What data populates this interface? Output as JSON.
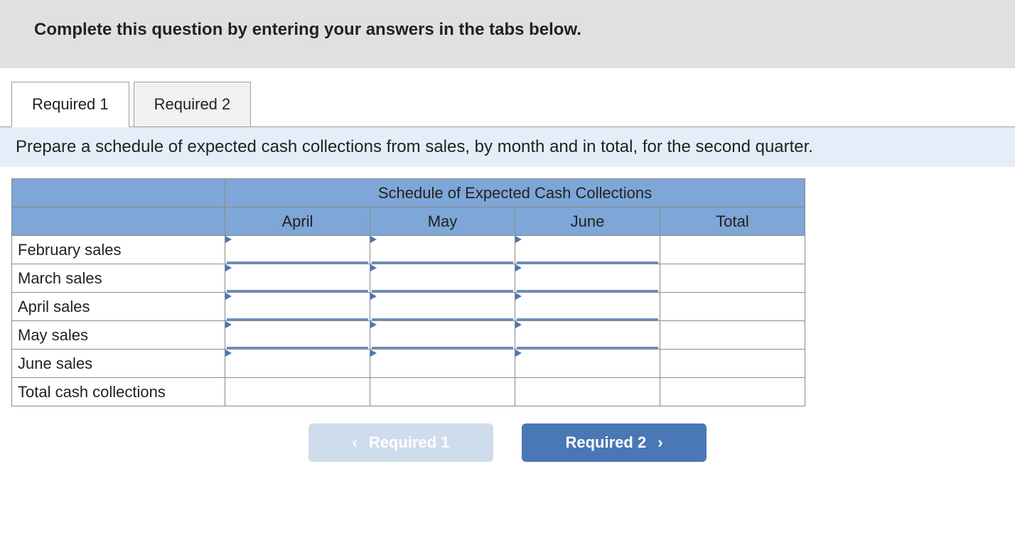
{
  "header": {
    "title": "Complete this question by entering your answers in the tabs below."
  },
  "tabs": [
    {
      "label": "Required 1",
      "active": true
    },
    {
      "label": "Required 2",
      "active": false
    }
  ],
  "prompt": "Prepare a schedule of expected cash collections from sales, by month and in total, for the second quarter.",
  "table": {
    "title": "Schedule of Expected Cash Collections",
    "columns": [
      "April",
      "May",
      "June",
      "Total"
    ],
    "rows": [
      {
        "label": "February sales",
        "editable": [
          true,
          true,
          true
        ],
        "total": ""
      },
      {
        "label": "March sales",
        "editable": [
          true,
          true,
          true
        ],
        "total": ""
      },
      {
        "label": "April sales",
        "editable": [
          true,
          true,
          true
        ],
        "total": ""
      },
      {
        "label": "May sales",
        "editable": [
          true,
          true,
          true
        ],
        "total": ""
      },
      {
        "label": "June sales",
        "editable": [
          true,
          true,
          true
        ],
        "total": ""
      }
    ],
    "totals_row_label": "Total cash collections"
  },
  "nav": {
    "prev_label": "Required 1",
    "next_label": "Required 2"
  }
}
